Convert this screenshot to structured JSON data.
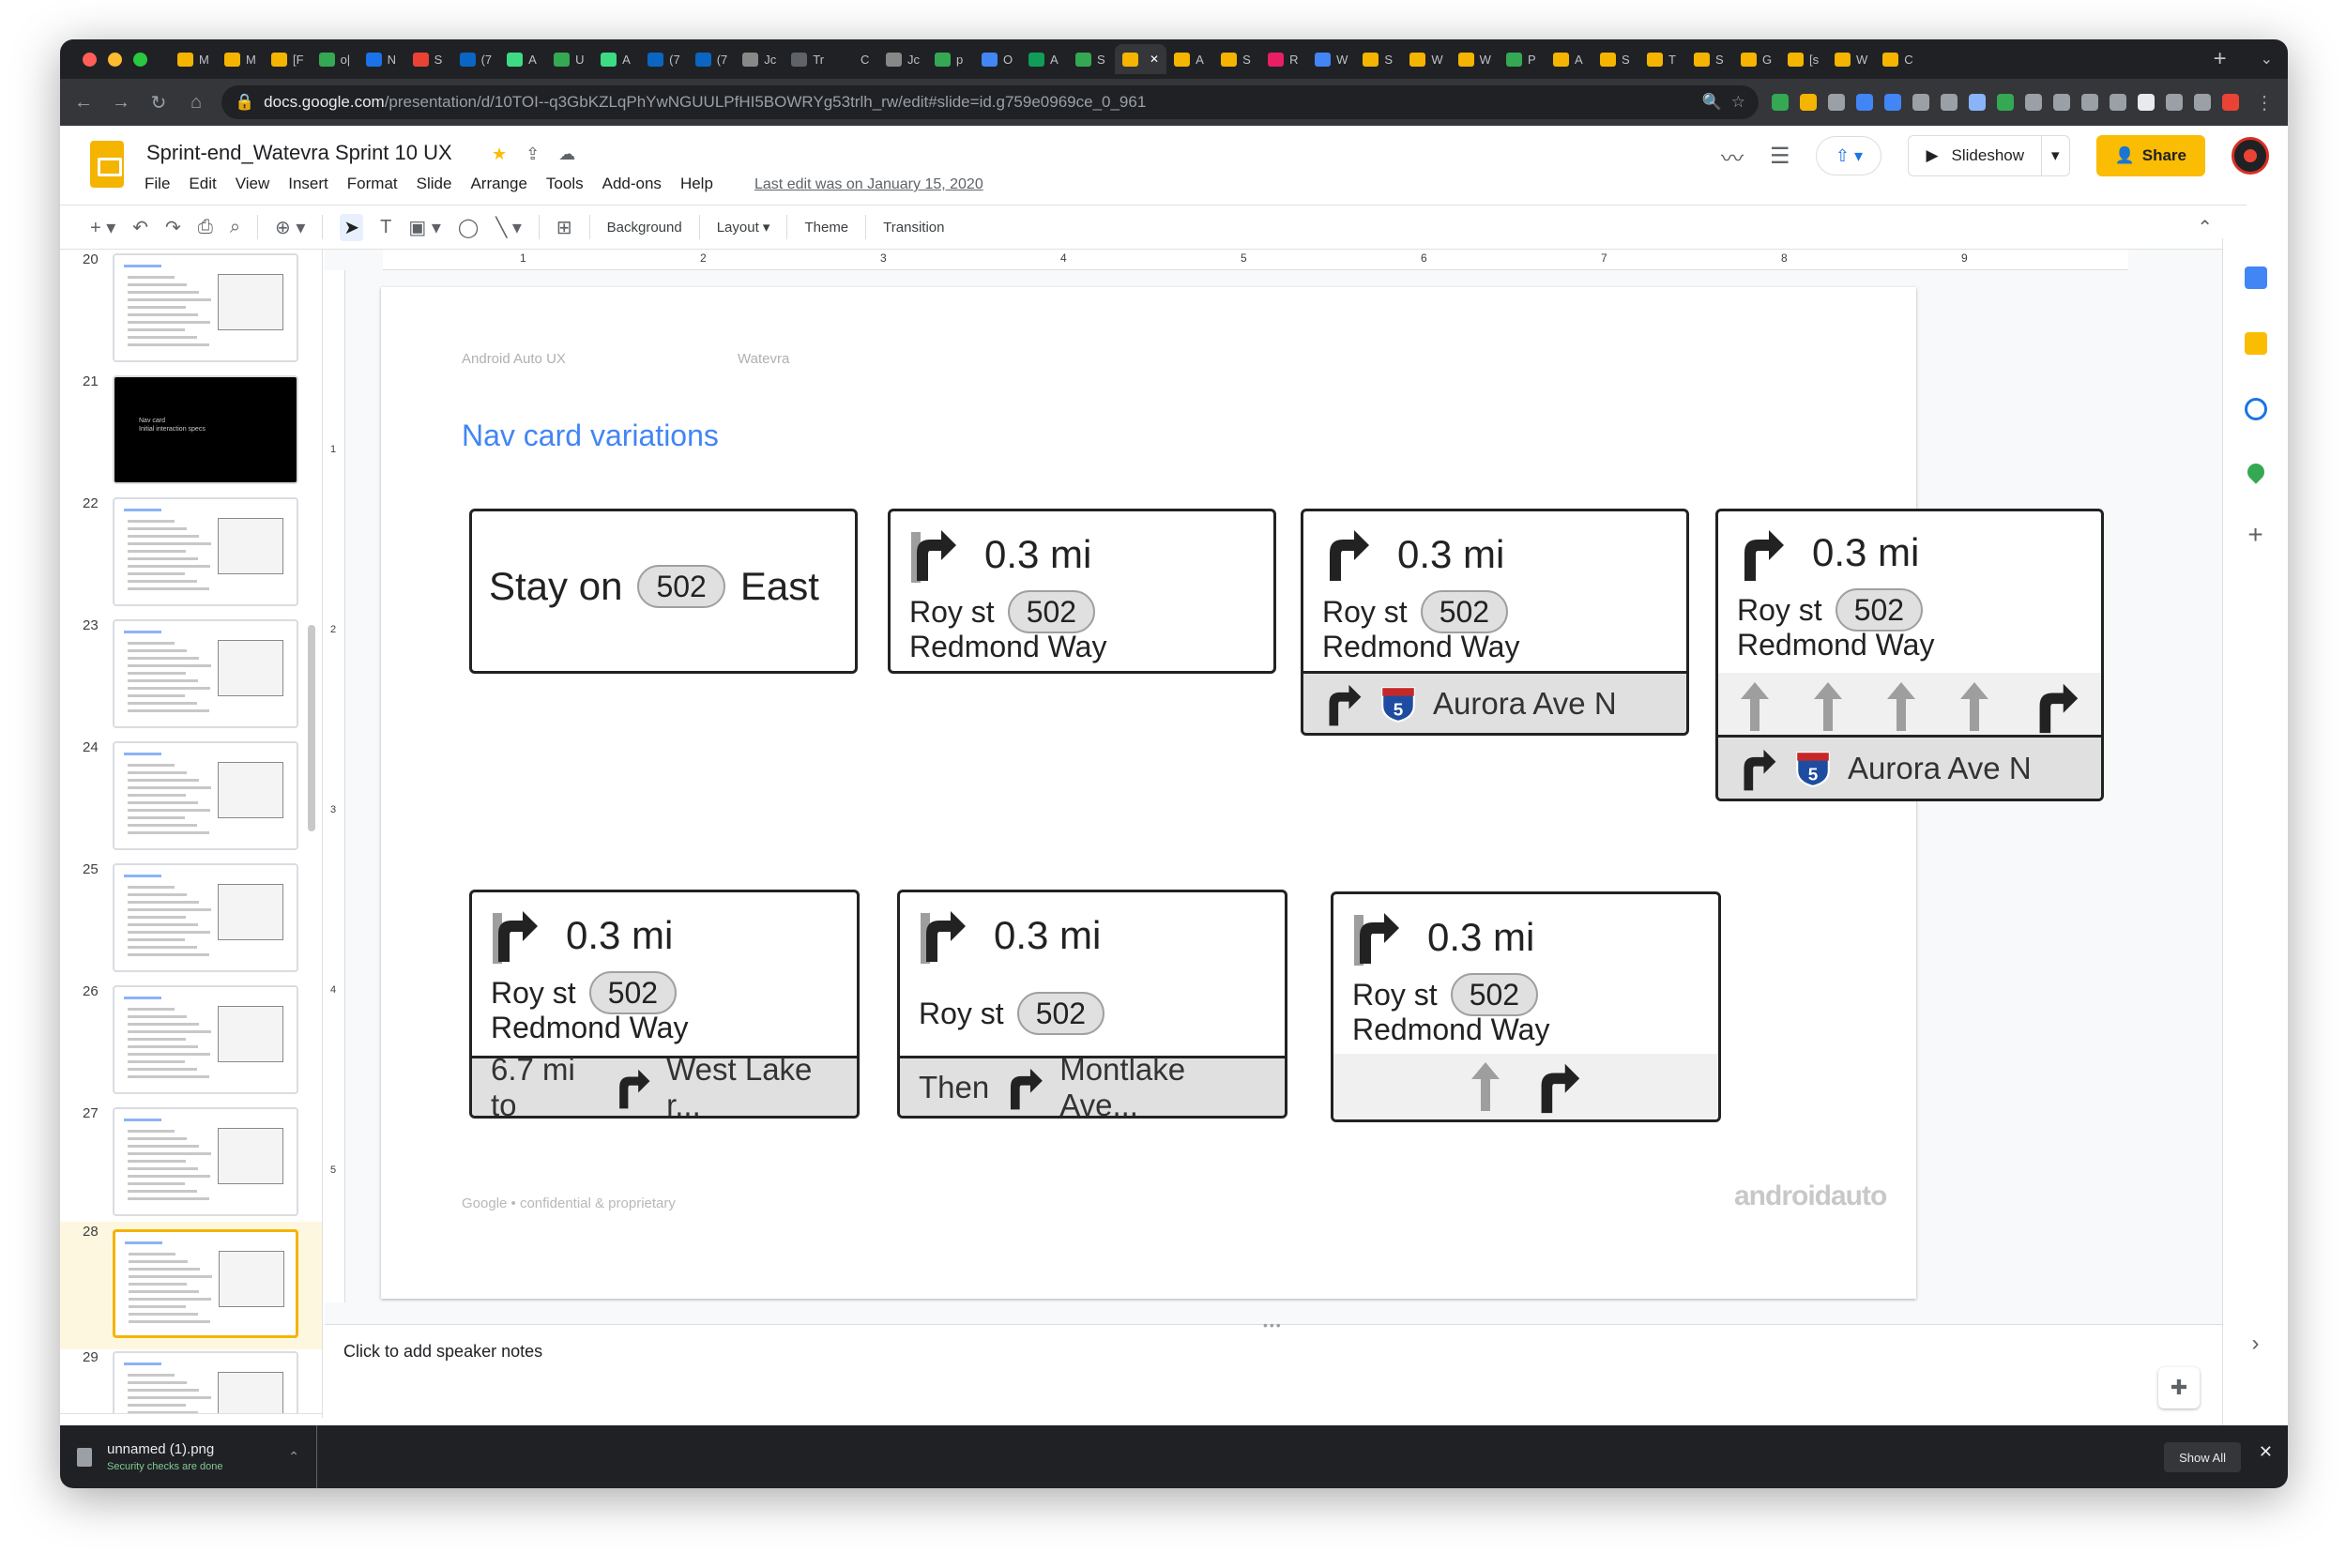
{
  "browser": {
    "tabs": [
      {
        "label": "M",
        "color": "#f4b400"
      },
      {
        "label": "M",
        "color": "#f4b400"
      },
      {
        "label": "[F",
        "color": "#f4b400"
      },
      {
        "label": "o|",
        "color": "#34a853"
      },
      {
        "label": "N",
        "color": "#1a73e8"
      },
      {
        "label": "S",
        "color": "#ea4335"
      },
      {
        "label": "(7",
        "color": "#0a66c2"
      },
      {
        "label": "A",
        "color": "#3ddc84"
      },
      {
        "label": "U",
        "color": "#34a853"
      },
      {
        "label": "A",
        "color": "#3ddc84"
      },
      {
        "label": "(7",
        "color": "#0a66c2"
      },
      {
        "label": "(7",
        "color": "#0a66c2"
      },
      {
        "label": "Jc",
        "color": "#888888"
      },
      {
        "label": "Tr",
        "color": "#5f6368"
      },
      {
        "label": "C",
        "color": "#202124"
      },
      {
        "label": "Jc",
        "color": "#888888"
      },
      {
        "label": "p",
        "color": "#34a853"
      },
      {
        "label": "O",
        "color": "#4285f4"
      },
      {
        "label": "A",
        "color": "#0f9d58"
      },
      {
        "label": "S",
        "color": "#34a853"
      },
      {
        "label": "",
        "color": "#f4b400",
        "active": true
      },
      {
        "label": "A",
        "color": "#f4b400"
      },
      {
        "label": "S",
        "color": "#f4b400"
      },
      {
        "label": "R",
        "color": "#e91e63"
      },
      {
        "label": "W",
        "color": "#4285f4"
      },
      {
        "label": "S",
        "color": "#f4b400"
      },
      {
        "label": "W",
        "color": "#f4b400"
      },
      {
        "label": "W",
        "color": "#f4b400"
      },
      {
        "label": "P",
        "color": "#34a853"
      },
      {
        "label": "A",
        "color": "#f4b400"
      },
      {
        "label": "S",
        "color": "#f4b400"
      },
      {
        "label": "T",
        "color": "#f4b400"
      },
      {
        "label": "S",
        "color": "#f4b400"
      },
      {
        "label": "G",
        "color": "#f4b400"
      },
      {
        "label": "[s",
        "color": "#f4b400"
      },
      {
        "label": "W",
        "color": "#f4b400"
      },
      {
        "label": "C",
        "color": "#f4b400"
      }
    ],
    "url_host": "docs.google.com",
    "url_path": "/presentation/d/10TOI--q3GbKZLqPhYwNGUULPfHI5BOWRYg53trlh_rw/edit#slide=id.g759e0969ce_0_961",
    "icons": [
      "back-icon",
      "forward-icon",
      "reload-icon",
      "home-icon",
      "lock-icon",
      "zoom-icon",
      "star-icon"
    ],
    "extension_colors": [
      "#34a853",
      "#f4b400",
      "#9aa0a6",
      "#4285f4",
      "#4285f4",
      "#9aa0a6",
      "#9aa0a6",
      "#8ab4f8",
      "#34a853",
      "#9aa0a6",
      "#9aa0a6",
      "#9aa0a6",
      "#9aa0a6",
      "#e8eaed",
      "#9aa0a6",
      "#9aa0a6",
      "#ea4335"
    ]
  },
  "docs": {
    "title": "Sprint-end_Watevra Sprint 10 UX",
    "menu": [
      "File",
      "Edit",
      "View",
      "Insert",
      "Format",
      "Slide",
      "Arrange",
      "Tools",
      "Add-ons",
      "Help"
    ],
    "last_edit": "Last edit was on January 15, 2020",
    "slideshow_label": "Slideshow",
    "share_label": "Share",
    "toolbar": {
      "background": "Background",
      "layout": "Layout",
      "theme": "Theme",
      "transition": "Transition"
    }
  },
  "filmstrip": {
    "slides": [
      {
        "num": "20"
      },
      {
        "num": "21",
        "title": "Nav card",
        "subtitle": "Initial interaction specs"
      },
      {
        "num": "22"
      },
      {
        "num": "23"
      },
      {
        "num": "24"
      },
      {
        "num": "25"
      },
      {
        "num": "26"
      },
      {
        "num": "27"
      },
      {
        "num": "28",
        "selected": true
      },
      {
        "num": "29"
      }
    ]
  },
  "ruler": {
    "h": [
      "1",
      "2",
      "3",
      "4",
      "5",
      "6",
      "7",
      "8",
      "9"
    ],
    "v": [
      "1",
      "2",
      "3",
      "4",
      "5"
    ]
  },
  "slide": {
    "header_left": "Android Auto UX",
    "header_right": "Watevra",
    "title": "Nav card variations",
    "footer": "Google • confidential & proprietary",
    "logo": "androidauto",
    "cards": {
      "c1": {
        "text_before": "Stay on",
        "shield": "502",
        "text_after": "East"
      },
      "c2": {
        "distance": "0.3 mi",
        "street": "Roy st",
        "shield": "502",
        "line2": "Redmond Way"
      },
      "c3": {
        "distance": "0.3 mi",
        "street": "Roy st",
        "shield": "502",
        "line2": "Redmond Way",
        "next_road": "Aurora Ave N",
        "interstate": "5"
      },
      "c4": {
        "distance": "0.3 mi",
        "street": "Roy st",
        "shield": "502",
        "line2": "Redmond Way",
        "next_road": "Aurora Ave N",
        "interstate": "5"
      },
      "c5": {
        "distance": "0.3 mi",
        "street": "Roy st",
        "shield": "502",
        "line2": "Redmond Way",
        "sub_prefix": "6.7 mi to",
        "sub_road": "West Lake r..."
      },
      "c6": {
        "distance": "0.3 mi",
        "street": "Roy st",
        "shield": "502",
        "sub_prefix": "Then",
        "sub_road": "Montlake Ave..."
      },
      "c7": {
        "distance": "0.3 mi",
        "street": "Roy st",
        "shield": "502",
        "line2": "Redmond Way"
      }
    }
  },
  "notes": {
    "placeholder": "Click to add speaker notes"
  },
  "download": {
    "filename": "unnamed (1).png",
    "status": "Security checks are done",
    "show_all": "Show All"
  }
}
